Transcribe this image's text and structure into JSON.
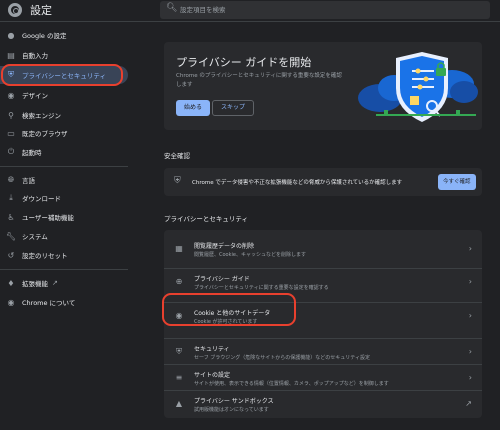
{
  "header": {
    "title": "設定",
    "search_placeholder": "設定項目を検索",
    "search_icon": "search-icon"
  },
  "sidebar": {
    "items": [
      {
        "label": "Google の設定",
        "icon": "google-icon"
      },
      {
        "label": "自動入力",
        "icon": "clipboard-icon"
      },
      {
        "label": "プライバシーとセキュリティ",
        "icon": "shield-icon",
        "active": true
      },
      {
        "label": "デザイン",
        "icon": "palette-icon"
      },
      {
        "label": "検索エンジン",
        "icon": "search-icon"
      },
      {
        "label": "既定のブラウザ",
        "icon": "browser-icon"
      },
      {
        "label": "起動時",
        "icon": "power-icon"
      },
      {
        "label": "言語",
        "icon": "globe-icon"
      },
      {
        "label": "ダウンロード",
        "icon": "download-icon"
      },
      {
        "label": "ユーザー補助機能",
        "icon": "accessibility-icon"
      },
      {
        "label": "システム",
        "icon": "wrench-icon"
      },
      {
        "label": "設定のリセット",
        "icon": "reset-icon"
      },
      {
        "label": "拡張機能",
        "icon": "puzzle-icon"
      },
      {
        "label": "Chrome について",
        "icon": "chrome-icon"
      }
    ]
  },
  "guide": {
    "title": "プライバシー ガイドを開始",
    "description": "Chrome のプライバシーとセキュリティに関する重要な設定を確認します",
    "start_label": "始める",
    "skip_label": "スキップ"
  },
  "safety": {
    "section_title": "安全確認",
    "text": "Chrome でデータ侵害や不正な拡張機能などの脅威から保護されているか確認します",
    "button_label": "今すぐ確認"
  },
  "privacy": {
    "section_title": "プライバシーとセキュリティ",
    "rows": [
      {
        "title": "閲覧履歴データの削除",
        "subtitle": "閲覧履歴、Cookie、キャッシュなどを削除します",
        "icon": "trash-icon"
      },
      {
        "title": "プライバシー ガイド",
        "subtitle": "プライバシーとセキュリティに関する重要な設定を確認する",
        "icon": "plus-circle-icon"
      },
      {
        "title": "Cookie と他のサイトデータ",
        "subtitle": "Cookie が許可されています",
        "icon": "cookie-icon"
      },
      {
        "title": "セキュリティ",
        "subtitle": "セーフ ブラウジング（危険なサイトからの保護機能）などのセキュリティ設定",
        "icon": "shield-icon"
      },
      {
        "title": "サイトの設定",
        "subtitle": "サイトが使用、表示できる情報（位置情報、カメラ、ポップアップなど）を制御します",
        "icon": "sliders-icon"
      },
      {
        "title": "プライバシー サンドボックス",
        "subtitle": "試用版機能はオンになっています",
        "icon": "flask-icon"
      }
    ]
  },
  "colors": {
    "accent": "#8ab4f8",
    "highlight_ring": "#e8402e",
    "background": "#202124",
    "card": "#292a2d"
  }
}
